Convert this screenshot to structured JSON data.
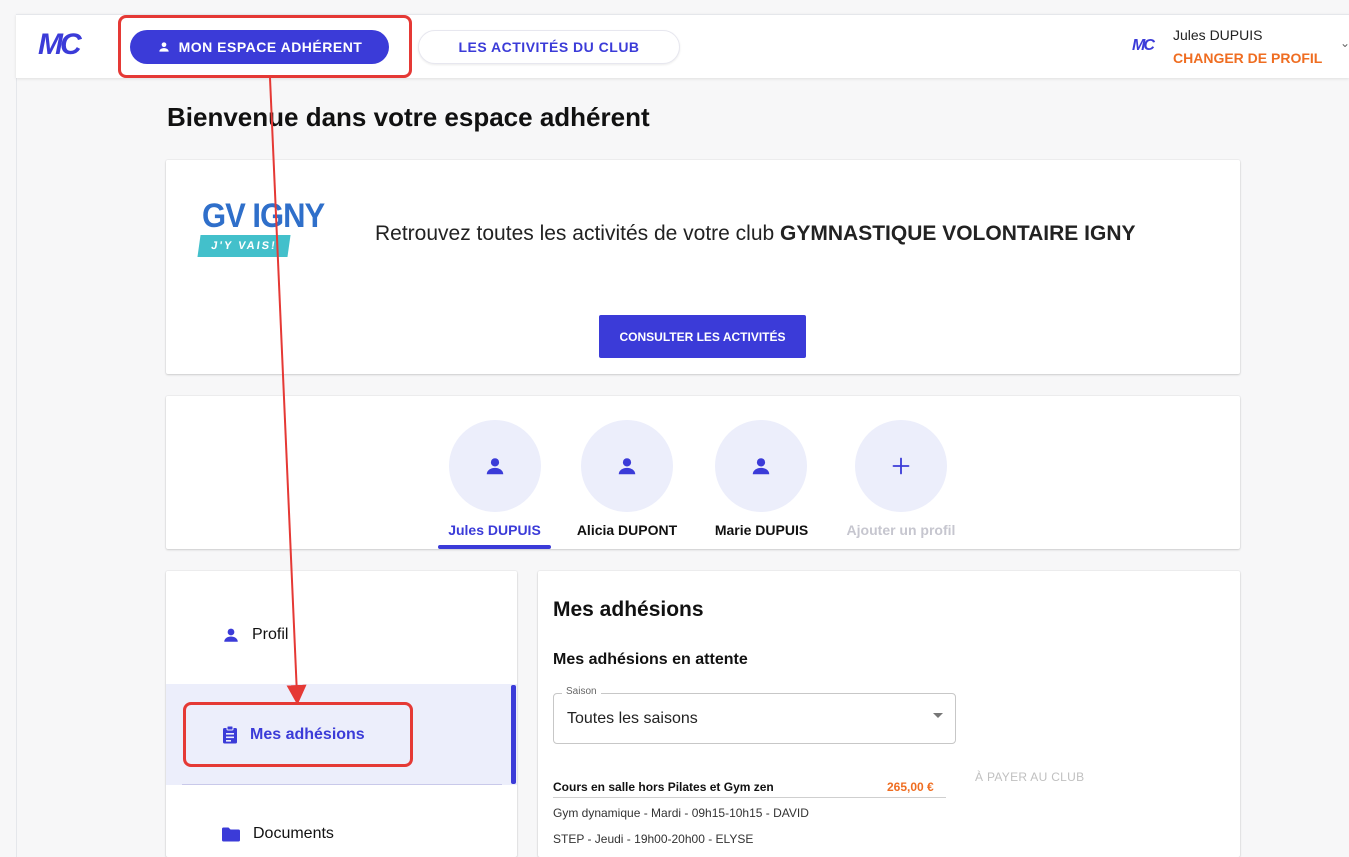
{
  "header": {
    "logo": "MC",
    "nav_primary": "MON ESPACE ADHÉRENT",
    "nav_secondary": "LES ACTIVITÉS DU CLUB",
    "user_logo": "MC",
    "user_name": "Jules DUPUIS",
    "change_profile": "CHANGER DE PROFIL"
  },
  "page": {
    "title": "Bienvenue dans votre espace adhérent"
  },
  "club": {
    "logo_name": "GV IGNY",
    "logo_tag": "J'Y VAIS!",
    "text_prefix": "Retrouvez toutes les activités de votre club ",
    "text_name": "GYMNASTIQUE VOLONTAIRE IGNY",
    "cta": "CONSULTER LES ACTIVITÉS"
  },
  "profiles": [
    {
      "name": "Jules DUPUIS",
      "state": "active"
    },
    {
      "name": "Alicia DUPONT",
      "state": "normal"
    },
    {
      "name": "Marie DUPUIS",
      "state": "normal"
    },
    {
      "name": "Ajouter un profil",
      "state": "add"
    }
  ],
  "sidebar": {
    "items": [
      {
        "label": "Profil",
        "icon": "user-icon"
      },
      {
        "label": "Mes adhésions",
        "icon": "clipboard-icon",
        "active": true
      },
      {
        "label": "Documents",
        "icon": "folder-icon"
      }
    ]
  },
  "main": {
    "title": "Mes adhésions",
    "subtitle": "Mes adhésions en attente",
    "season_label": "Saison",
    "season_value": "Toutes les saisons",
    "membership": {
      "title": "Cours en salle hors Pilates et Gym zen",
      "price": "265,00 €",
      "status": "À PAYER AU CLUB",
      "details": [
        "Gym dynamique - Mardi - 09h15-10h15 - DAVID",
        "STEP - Jeudi - 19h00-20h00 - ELYSE"
      ]
    }
  },
  "colors": {
    "primary": "#3b3bd8",
    "accent": "#ef6d21",
    "annotation": "#e53935"
  }
}
